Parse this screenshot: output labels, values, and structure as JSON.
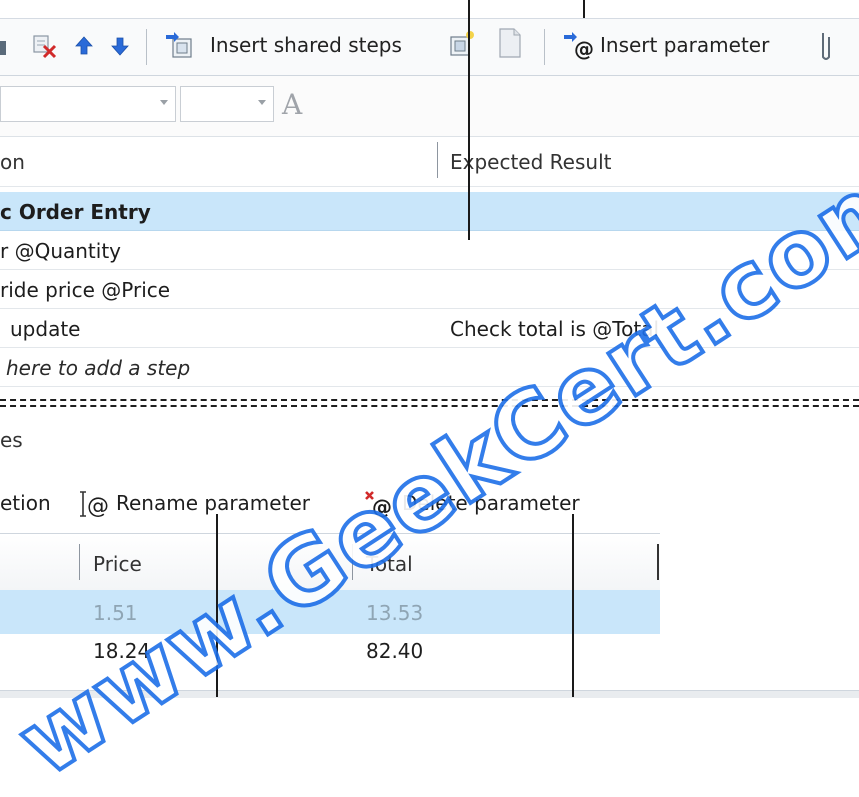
{
  "toolbar": {
    "insert_shared_steps_label": "Insert shared steps",
    "insert_parameter_label": "Insert parameter"
  },
  "format_bar": {
    "font_glyph": "A"
  },
  "steps": {
    "columns": {
      "action": "on",
      "expected_result": "Expected Result"
    },
    "rows": [
      {
        "action": "c Order Entry",
        "expected": "",
        "style": "bold",
        "selected": true
      },
      {
        "action": "r @Quantity",
        "expected": "",
        "style": "normal",
        "selected": false
      },
      {
        "action": "ride price @Price",
        "expected": "",
        "style": "normal",
        "selected": false
      },
      {
        "action": "update",
        "expected": "Check total is @Total",
        "style": "normal",
        "selected": false
      },
      {
        "action": "here to add a step",
        "expected": "",
        "style": "italic",
        "selected": false
      }
    ]
  },
  "parameters": {
    "title": "es",
    "toolbar": {
      "first_label": "etion",
      "rename_label": "Rename parameter",
      "delete_label": "Delete parameter"
    },
    "columns": [
      "Price",
      "Total"
    ],
    "rows": [
      {
        "price": "1.51",
        "total": "13.53",
        "selected": true
      },
      {
        "price": "18.24",
        "total": "82.40",
        "selected": false
      }
    ]
  },
  "watermark": "www.GeekCert.com",
  "colors": {
    "selection": "#c9e6fa",
    "watermark_outline": "#1e6fe8",
    "icon_blue": "#2a6ad8"
  }
}
